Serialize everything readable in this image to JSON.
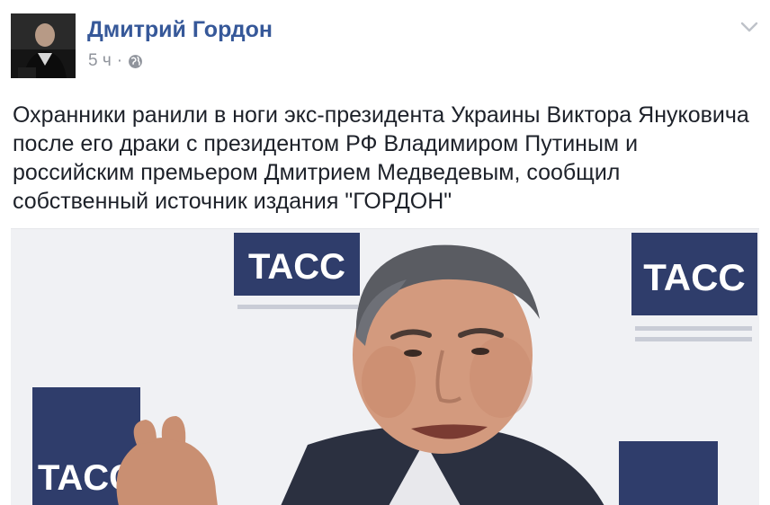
{
  "post": {
    "author_name": "Дмитрий Гордон",
    "timestamp": "5 ч",
    "separator": "·",
    "privacy_icon": "globe-icon",
    "menu_icon": "chevron-down-icon",
    "text": "Охранники ранили в ноги экс-президента Украины Виктора Януковича после его драки с президентом РФ Владимиром Путиным и российским премьером Дмитрием Медведевым, сообщил собственный источник издания \"ГОРДОН\""
  },
  "photo": {
    "logo_text": "TACC",
    "logo_color": "#2f3d6b"
  },
  "colors": {
    "author_link": "#365899",
    "meta_text": "#90949c",
    "body_text": "#1d2129"
  }
}
